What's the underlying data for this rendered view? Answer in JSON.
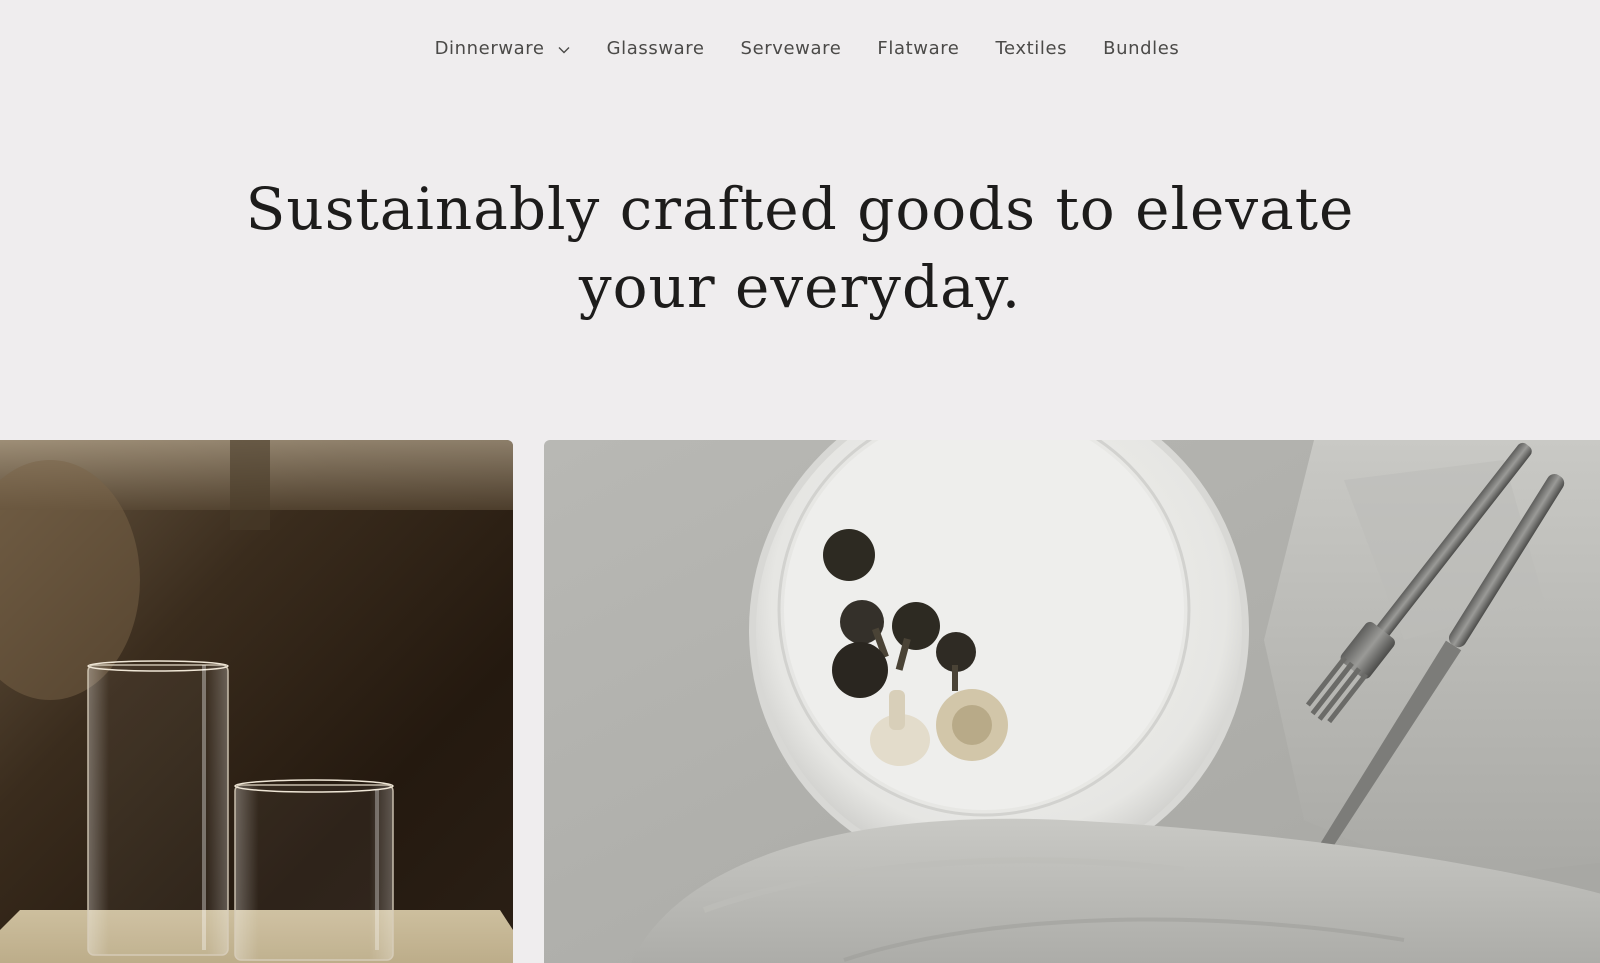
{
  "nav": {
    "items": [
      {
        "label": "Dinnerware",
        "has_dropdown": true,
        "icon": "chevron-down-icon"
      },
      {
        "label": "Glassware"
      },
      {
        "label": "Serveware"
      },
      {
        "label": "Flatware"
      },
      {
        "label": "Textiles"
      },
      {
        "label": "Bundles"
      }
    ]
  },
  "hero": {
    "headline": "Sustainably crafted goods to elevate your everyday."
  },
  "images": {
    "left": {
      "subject": "glassware"
    },
    "right": {
      "subject": "dinnerware"
    }
  },
  "colors": {
    "background": "#efedee",
    "text": "#1d1c1b",
    "nav_text": "#4b4a48"
  }
}
